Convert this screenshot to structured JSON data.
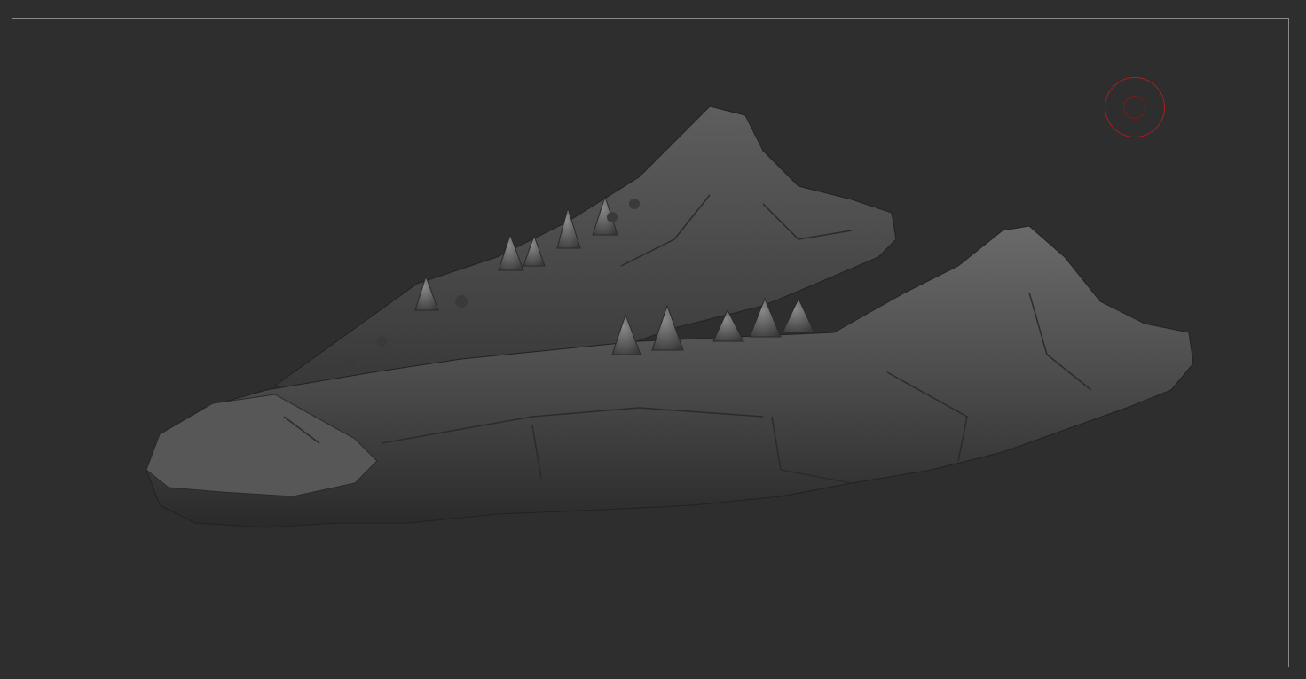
{
  "app": {
    "background_color": "#2e2e2e",
    "frame_color": "#8a8a8a"
  },
  "viewport": {
    "subject": "sculpted-fossil-jaw-model"
  },
  "brush": {
    "icon": "brush-cursor-icon",
    "color": "#b01c1c"
  }
}
